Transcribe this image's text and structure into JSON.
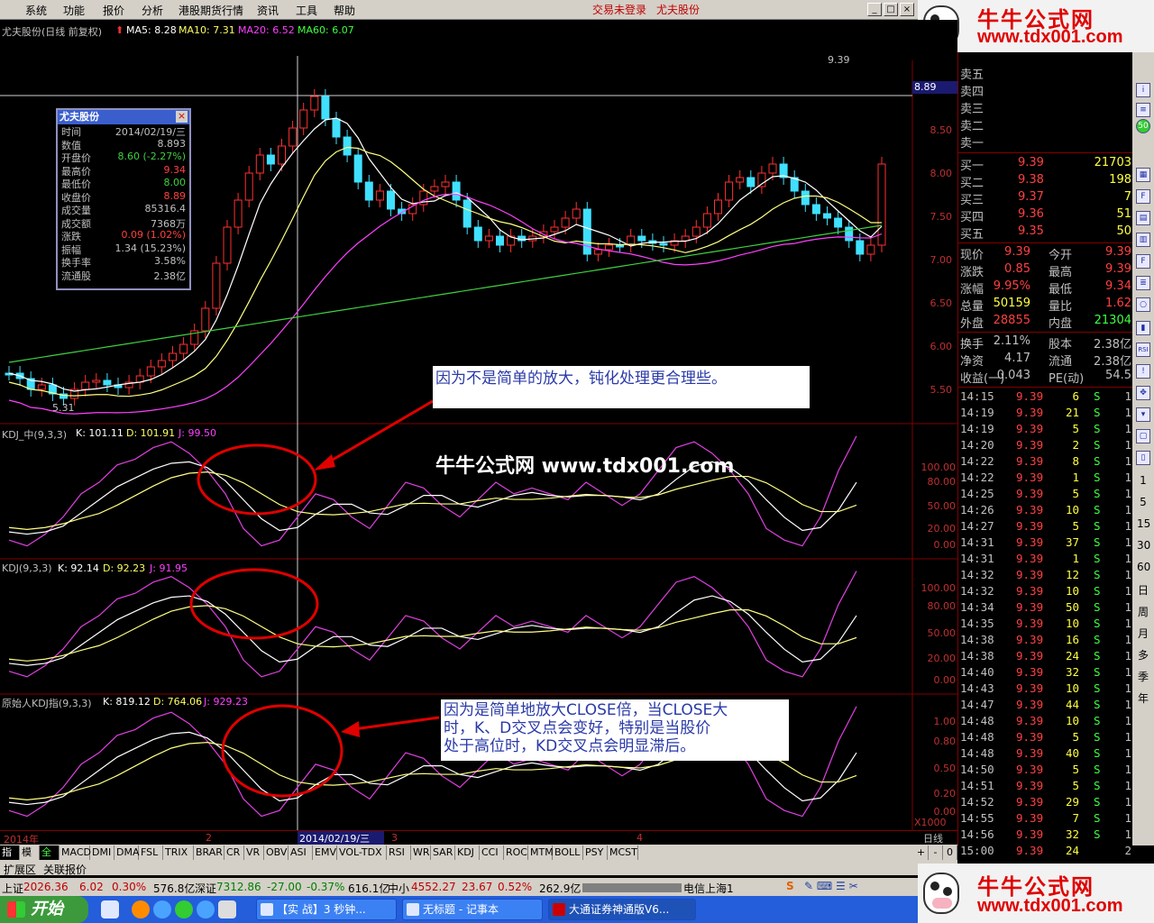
{
  "menu": {
    "items": [
      "系统",
      "功能",
      "报价",
      "分析",
      "港股期货行情",
      "资讯",
      "工具",
      "帮助"
    ],
    "login_status": "交易未登录",
    "stock_name": "尤夫股份"
  },
  "banner": {
    "title": "牛牛公式网",
    "url": "www.tdx001.com"
  },
  "chart": {
    "header_title": "尤夫股份(日线 前复权)",
    "ma5": "MA5: 8.28",
    "ma10": "MA10: 7.31",
    "ma20": "MA20: 6.52",
    "ma60": "MA60: 6.07",
    "price_axis": [
      "8.89",
      "8.50",
      "8.00",
      "7.50",
      "7.00",
      "6.50",
      "6.00",
      "5.50"
    ],
    "high_label": "9.39",
    "low_label": "5.31",
    "kdj_mid_title": "KDJ_中(9,3,3)",
    "kdj_mid_k": "K: 101.11",
    "kdj_mid_d": "D: 101.91",
    "kdj_mid_j": "J: 99.50",
    "kdj_mid_axis": [
      "100.00",
      "80.00",
      "50.00",
      "20.00",
      "0.00"
    ],
    "kdj_title": "KDJ(9,3,3)",
    "kdj_k": "K: 92.14",
    "kdj_d": "D: 92.23",
    "kdj_j": "J: 91.95",
    "kdj_axis": [
      "100.00",
      "80.00",
      "50.00",
      "20.00",
      "0.00"
    ],
    "kdj_raw_title": "原始人KDJ指(9,3,3)",
    "kdj_raw_k": "K: 819.12",
    "kdj_raw_d": "D: 764.06",
    "kdj_raw_j": "J: 929.23",
    "kdj_raw_axis": [
      "1.00",
      "0.80",
      "0.50",
      "0.20",
      "0.00"
    ],
    "x1000": "X1000",
    "period": "日线",
    "date_marks": [
      "2014年",
      "2",
      "3",
      "4"
    ],
    "cursor_date": "2014/02/19/三"
  },
  "info_box": {
    "title": "尤夫股份",
    "rows": [
      {
        "k": "时间",
        "v": "2014/02/19/三",
        "c": "#c0c0c0"
      },
      {
        "k": "数值",
        "v": "8.893",
        "c": "#c0c0c0"
      },
      {
        "k": "开盘价",
        "v": "8.60 (-2.27%)",
        "c": "#40d040"
      },
      {
        "k": "最高价",
        "v": "9.34",
        "c": "#ff4040"
      },
      {
        "k": "最低价",
        "v": "8.00",
        "c": "#40d040"
      },
      {
        "k": "收盘价",
        "v": "8.89",
        "c": "#ff4040"
      },
      {
        "k": "成交量",
        "v": "85316.4",
        "c": "#c0c0c0"
      },
      {
        "k": "成交额",
        "v": "7368万",
        "c": "#c0c0c0"
      },
      {
        "k": "涨跌",
        "v": "0.09 (1.02%)",
        "c": "#ff4040"
      },
      {
        "k": "振幅",
        "v": "1.34 (15.23%)",
        "c": "#c0c0c0"
      },
      {
        "k": "换手率",
        "v": "3.58%",
        "c": "#c0c0c0"
      },
      {
        "k": "流通股",
        "v": "2.38亿",
        "c": "#c0c0c0"
      }
    ]
  },
  "notes": {
    "note1": "因为不是简单的放大，钝化处理更合理些。",
    "note2_l1": "因为是简单地放大CLOSE倍，当CLOSE大",
    "note2_l2": "时，K、D交叉点会变好，特别是当股价",
    "note2_l3": "处于高位时，KD交叉点会明显滞后。",
    "watermark": "牛牛公式网 www.tdx001.com"
  },
  "indicator_tabs": [
    "指标",
    "模板",
    "全部",
    "MACD",
    "DMI",
    "DMA",
    "FSL",
    "TRIX",
    "BRAR",
    "CR",
    "VR",
    "OBV",
    "ASI",
    "EMV",
    "VOL-TDX",
    "RSI",
    "WR",
    "SAR",
    "KDJ",
    "CCI",
    "ROC",
    "MTM",
    "BOLL",
    "PSY",
    "MCST"
  ],
  "tab_controls": [
    "+",
    "-",
    "0"
  ],
  "ext_bar": {
    "a": "扩展区",
    "b": "关联报价"
  },
  "quote": {
    "sell": [
      "卖五",
      "卖四",
      "卖三",
      "卖二",
      "卖一"
    ],
    "buy": [
      {
        "k": "买一",
        "p": "9.39",
        "v": "21703"
      },
      {
        "k": "买二",
        "p": "9.38",
        "v": "198"
      },
      {
        "k": "买三",
        "p": "9.37",
        "v": "7"
      },
      {
        "k": "买四",
        "p": "9.36",
        "v": "51"
      },
      {
        "k": "买五",
        "p": "9.35",
        "v": "50"
      }
    ],
    "stats": [
      {
        "k1": "现价",
        "v1": "9.39",
        "c1": "#ff4040",
        "k2": "今开",
        "v2": "9.39",
        "c2": "#ff4040"
      },
      {
        "k1": "涨跌",
        "v1": "0.85",
        "c1": "#ff4040",
        "k2": "最高",
        "v2": "9.39",
        "c2": "#ff4040"
      },
      {
        "k1": "涨幅",
        "v1": "9.95%",
        "c1": "#ff4040",
        "k2": "最低",
        "v2": "9.34",
        "c2": "#ff4040"
      },
      {
        "k1": "总量",
        "v1": "50159",
        "c1": "#ffff40",
        "k2": "量比",
        "v2": "1.62",
        "c2": "#ff4040"
      },
      {
        "k1": "外盘",
        "v1": "28855",
        "c1": "#ff4040",
        "k2": "内盘",
        "v2": "21304",
        "c2": "#40ff40"
      }
    ],
    "stats2": [
      {
        "k1": "换手",
        "v1": "2.11%",
        "k2": "股本",
        "v2": "2.38亿"
      },
      {
        "k1": "净资",
        "v1": "4.17",
        "k2": "流通",
        "v2": "2.38亿"
      },
      {
        "k1": "收益(一)",
        "v1": "0.043",
        "k2": "PE(动)",
        "v2": "54.5"
      }
    ],
    "ticks": [
      [
        "14:15",
        "9.39",
        "6",
        "S",
        "1"
      ],
      [
        "14:19",
        "9.39",
        "21",
        "S",
        "1"
      ],
      [
        "14:19",
        "9.39",
        "5",
        "S",
        "1"
      ],
      [
        "14:20",
        "9.39",
        "2",
        "S",
        "1"
      ],
      [
        "14:22",
        "9.39",
        "8",
        "S",
        "1"
      ],
      [
        "14:22",
        "9.39",
        "1",
        "S",
        "1"
      ],
      [
        "14:25",
        "9.39",
        "5",
        "S",
        "1"
      ],
      [
        "14:26",
        "9.39",
        "10",
        "S",
        "1"
      ],
      [
        "14:27",
        "9.39",
        "5",
        "S",
        "1"
      ],
      [
        "14:31",
        "9.39",
        "37",
        "S",
        "1"
      ],
      [
        "14:31",
        "9.39",
        "1",
        "S",
        "1"
      ],
      [
        "14:32",
        "9.39",
        "12",
        "S",
        "1"
      ],
      [
        "14:32",
        "9.39",
        "10",
        "S",
        "1"
      ],
      [
        "14:34",
        "9.39",
        "50",
        "S",
        "1"
      ],
      [
        "14:35",
        "9.39",
        "10",
        "S",
        "1"
      ],
      [
        "14:38",
        "9.39",
        "16",
        "S",
        "1"
      ],
      [
        "14:38",
        "9.39",
        "24",
        "S",
        "1"
      ],
      [
        "14:40",
        "9.39",
        "32",
        "S",
        "1"
      ],
      [
        "14:43",
        "9.39",
        "10",
        "S",
        "1"
      ],
      [
        "14:47",
        "9.39",
        "44",
        "S",
        "1"
      ],
      [
        "14:48",
        "9.39",
        "10",
        "S",
        "1"
      ],
      [
        "14:48",
        "9.39",
        "5",
        "S",
        "1"
      ],
      [
        "14:48",
        "9.39",
        "40",
        "S",
        "1"
      ],
      [
        "14:50",
        "9.39",
        "5",
        "S",
        "1"
      ],
      [
        "14:51",
        "9.39",
        "5",
        "S",
        "1"
      ],
      [
        "14:52",
        "9.39",
        "29",
        "S",
        "1"
      ],
      [
        "14:55",
        "9.39",
        "7",
        "S",
        "1"
      ],
      [
        "14:56",
        "9.39",
        "32",
        "S",
        "1"
      ],
      [
        "15:00",
        "9.39",
        "24",
        "",
        "2"
      ]
    ]
  },
  "right_toolbar": {
    "labels": [
      "1",
      "5",
      "15",
      "30",
      "60",
      "日",
      "周",
      "月",
      "多",
      "季",
      "年"
    ]
  },
  "statusbar": {
    "sh_label": "上证",
    "sh_val": "2026.36",
    "sh_chg": "6.02",
    "sh_pct": "0.30%",
    "sh_amt": "576.8亿",
    "sz_label": "深证",
    "sz_val": "7312.86",
    "sz_chg": "-27.00",
    "sz_pct": "-0.37%",
    "sz_amt": "616.1亿",
    "zx_label": "中小",
    "zx_val": "4552.27",
    "zx_chg": "23.67",
    "zx_pct": "0.52%",
    "zx_amt": "262.9亿",
    "server": "电信上海1"
  },
  "taskbar": {
    "start": "开始",
    "tasks": [
      "【实  战】3 秒钟...",
      "无标题 - 记事本",
      "大通证券神通版V6..."
    ]
  }
}
